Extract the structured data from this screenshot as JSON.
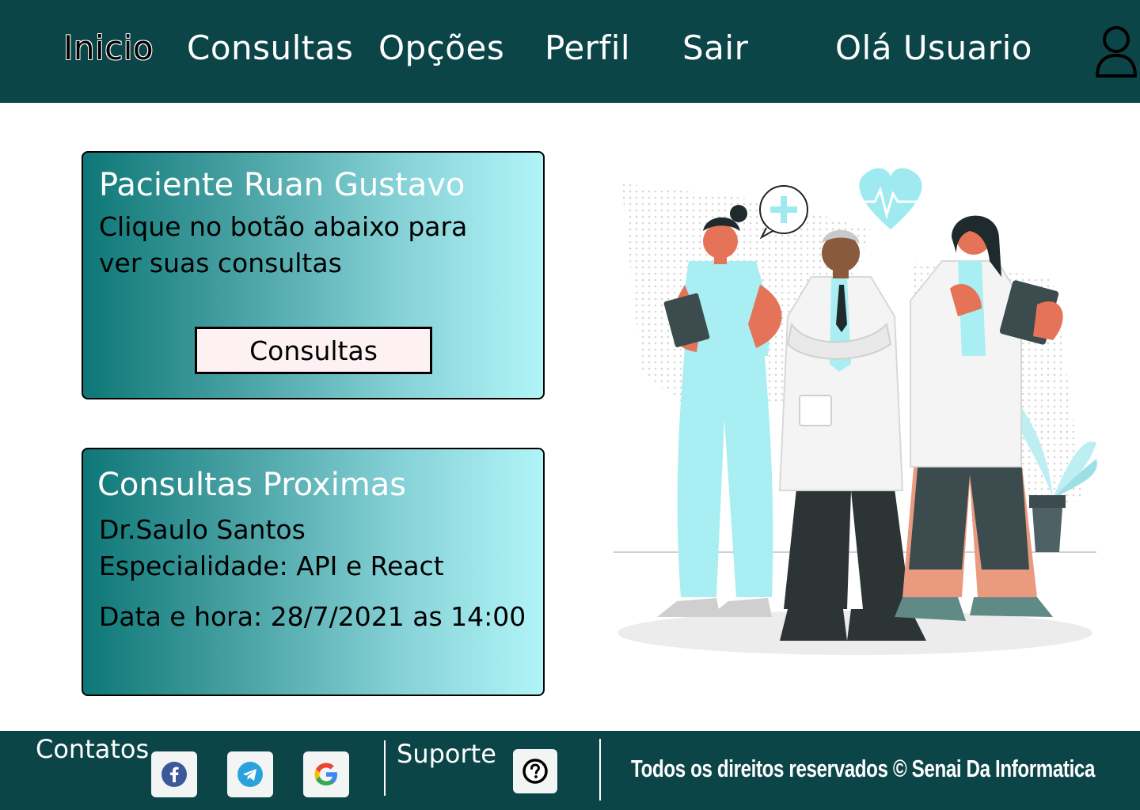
{
  "header": {
    "nav": {
      "inicio": "Inicio",
      "consultas": "Consultas",
      "opcoes": "Opções",
      "perfil": "Perfil",
      "sair": "Sair"
    },
    "greeting": "Olá Usuario"
  },
  "patient_card": {
    "title": "Paciente Ruan Gustavo",
    "line1": "Clique no botão abaixo para",
    "line2": "ver suas consultas",
    "button_label": "Consultas"
  },
  "upcoming_card": {
    "title": "Consultas Proximas",
    "doctor": "Dr.Saulo Santos",
    "specialty": "Especialidade: API e React",
    "datetime": "Data e hora: 28/7/2021 as 14:00"
  },
  "footer": {
    "contacts_label": "Contatos",
    "support_label": "Suporte",
    "copyright": "Todos os direitos reservados © Senai Da Informatica"
  },
  "colors": {
    "header_bg": "#0b4547",
    "card_gradient_start": "#0e7777",
    "card_gradient_end": "#b1f4f7",
    "button_bg": "#fdf1f3"
  },
  "icons": [
    "user-icon",
    "facebook-icon",
    "telegram-icon",
    "google-icon",
    "help-icon"
  ]
}
